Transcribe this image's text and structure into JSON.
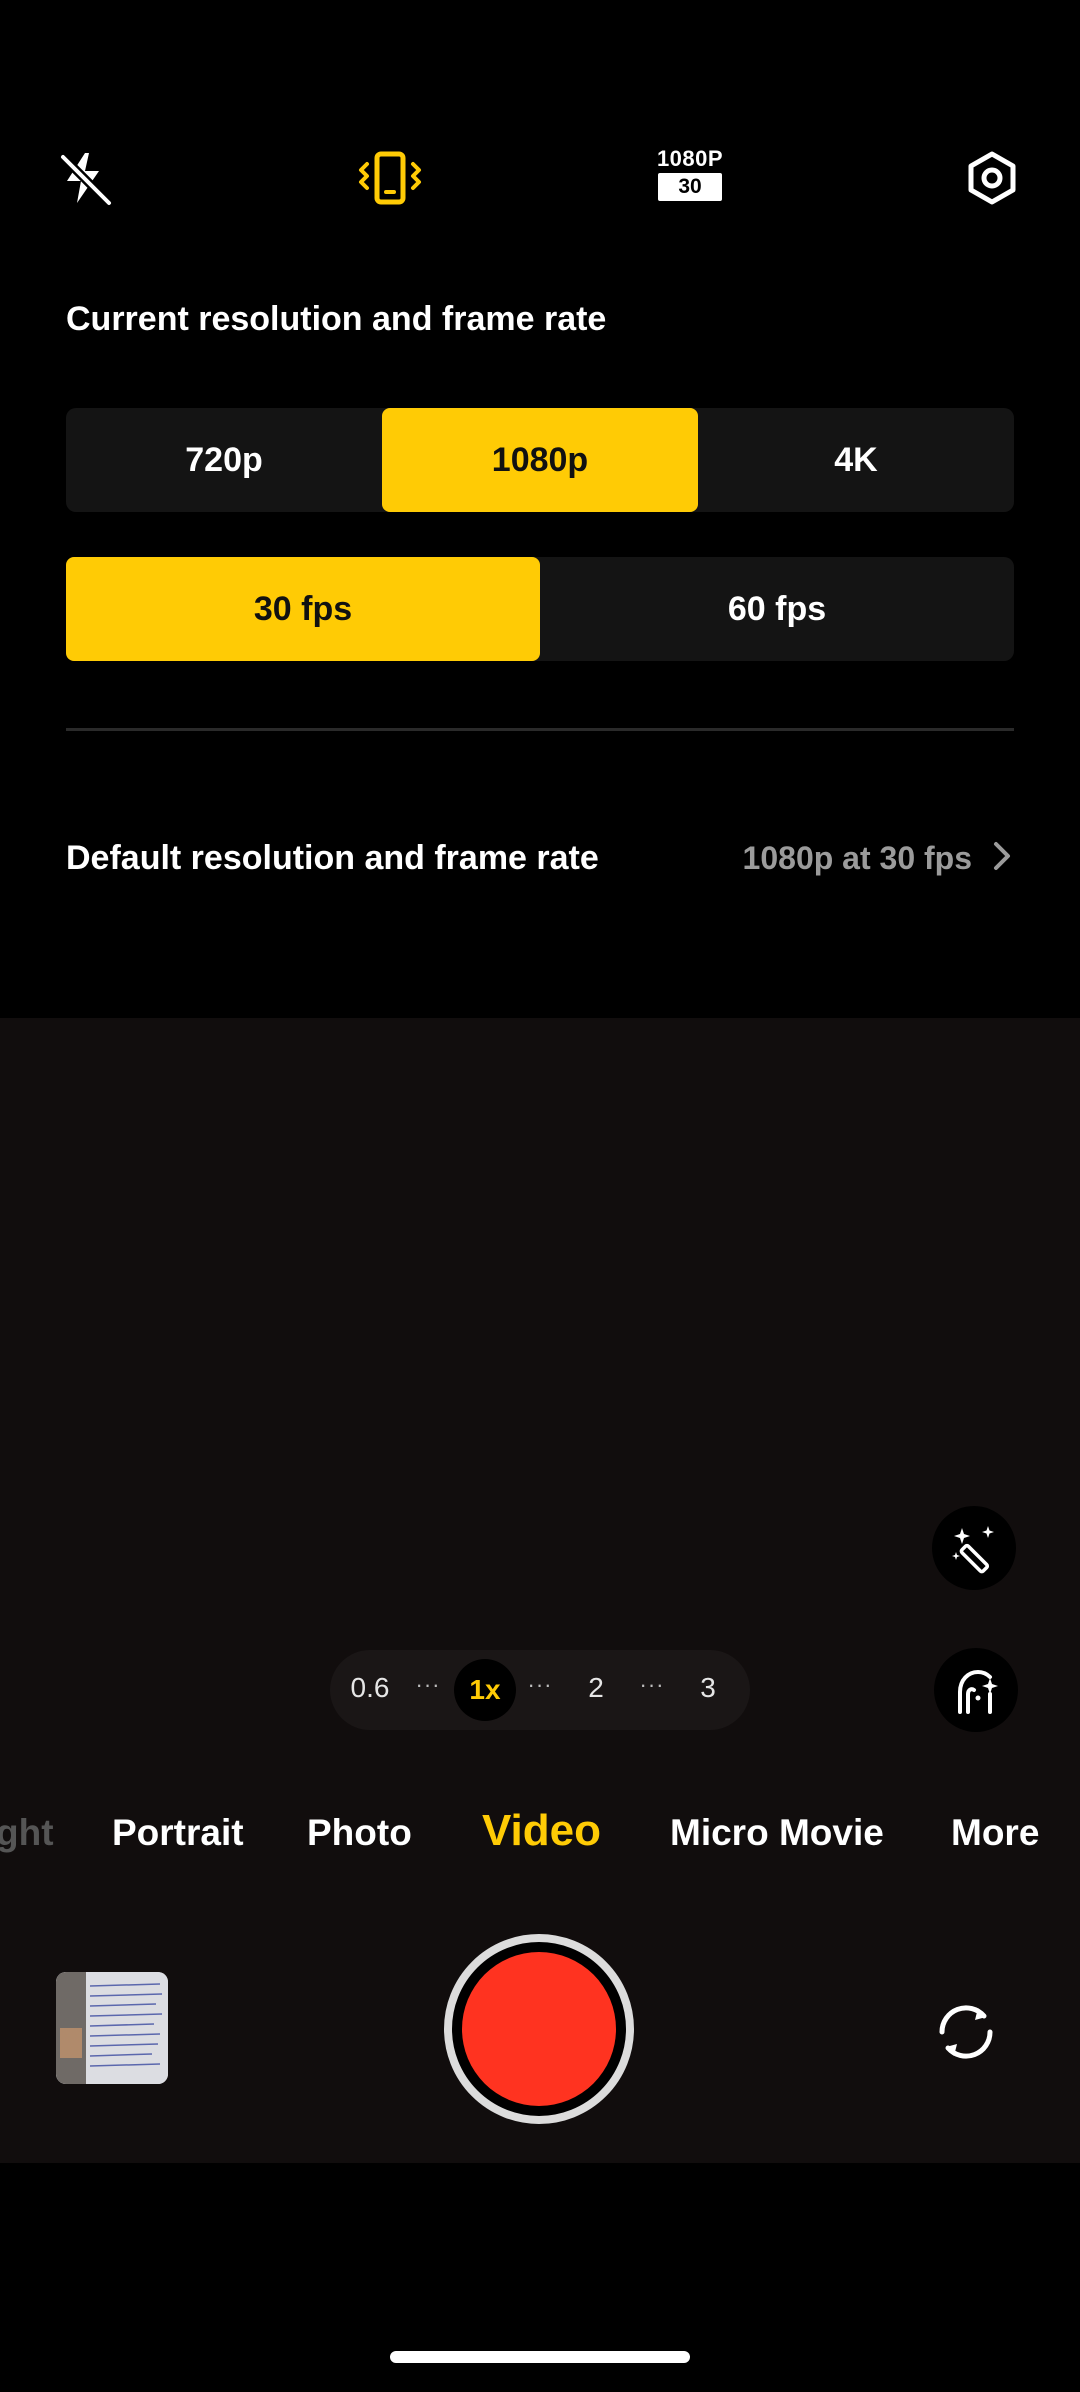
{
  "top_bar": {
    "flash_icon": "flash-off-icon",
    "stabilization_icon": "stabilization-icon",
    "resolution_badge": {
      "resolution": "1080P",
      "fps": "30"
    },
    "settings_icon": "settings-icon"
  },
  "resolution_panel": {
    "title": "Current resolution and frame rate",
    "resolutions": [
      {
        "label": "720p",
        "selected": false
      },
      {
        "label": "1080p",
        "selected": true
      },
      {
        "label": "4K",
        "selected": false
      }
    ],
    "frame_rates": [
      {
        "label": "30 fps",
        "selected": true
      },
      {
        "label": "60 fps",
        "selected": false
      }
    ],
    "default_row": {
      "label": "Default resolution and frame rate",
      "value": "1080p at 30 fps"
    }
  },
  "zoom": {
    "levels": [
      "0.6",
      "1x",
      "2",
      "3"
    ],
    "selected": "1x"
  },
  "modes": {
    "items": [
      "ght",
      "Portrait",
      "Photo",
      "Video",
      "Micro Movie",
      "More"
    ],
    "selected": "Video"
  },
  "colors": {
    "accent": "#FFCB05",
    "record": "#FF3320",
    "background": "#000000"
  }
}
